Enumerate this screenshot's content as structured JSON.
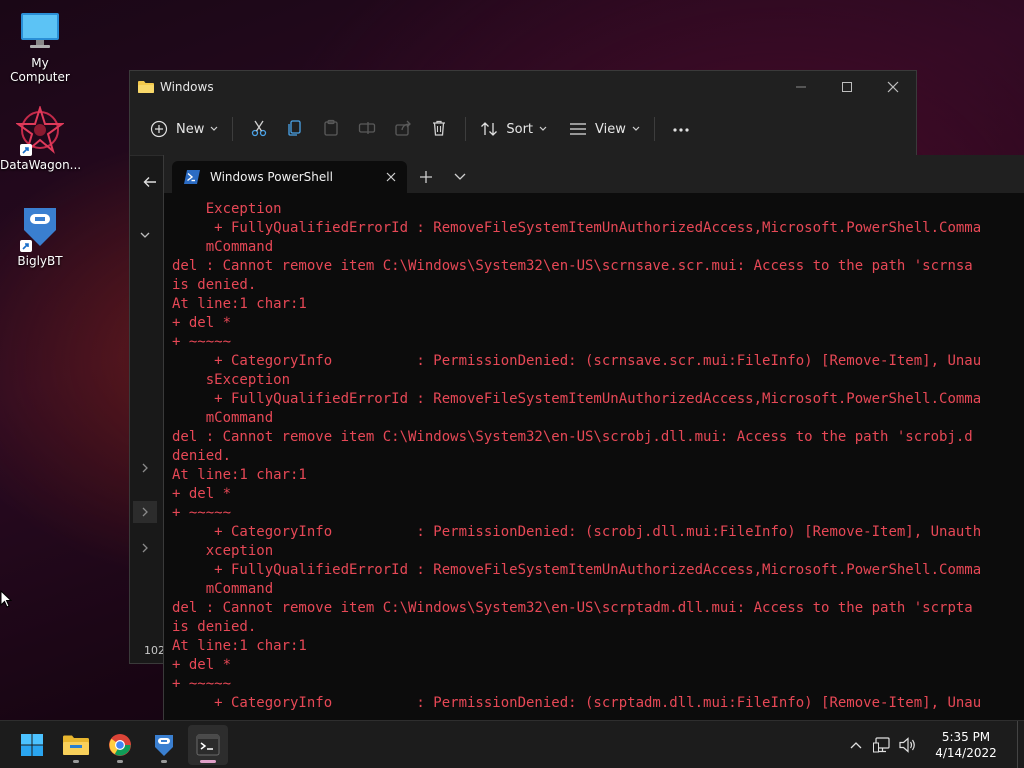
{
  "desktop": {
    "icons": [
      {
        "label": "My Computer"
      },
      {
        "label": "DataWagon..."
      },
      {
        "label": "BiglyBT"
      }
    ]
  },
  "explorer": {
    "title": "Windows",
    "toolbar": {
      "new_label": "New",
      "sort_label": "Sort",
      "view_label": "View"
    },
    "status_count": "102"
  },
  "terminal": {
    "tab_title": "Windows PowerShell",
    "lines": [
      "    Exception",
      "     + FullyQualifiedErrorId : RemoveFileSystemItemUnAuthorizedAccess,Microsoft.PowerShell.Comma",
      "    mCommand",
      "del : Cannot remove item C:\\Windows\\System32\\en-US\\scrnsave.scr.mui: Access to the path 'scrnsa",
      "is denied.",
      "At line:1 char:1",
      "+ del *",
      "+ ~~~~~",
      "     + CategoryInfo          : PermissionDenied: (scrnsave.scr.mui:FileInfo) [Remove-Item], Unau",
      "    sException",
      "     + FullyQualifiedErrorId : RemoveFileSystemItemUnAuthorizedAccess,Microsoft.PowerShell.Comma",
      "    mCommand",
      "del : Cannot remove item C:\\Windows\\System32\\en-US\\scrobj.dll.mui: Access to the path 'scrobj.d",
      "denied.",
      "At line:1 char:1",
      "+ del *",
      "+ ~~~~~",
      "     + CategoryInfo          : PermissionDenied: (scrobj.dll.mui:FileInfo) [Remove-Item], Unauth",
      "    xception",
      "     + FullyQualifiedErrorId : RemoveFileSystemItemUnAuthorizedAccess,Microsoft.PowerShell.Comma",
      "    mCommand",
      "del : Cannot remove item C:\\Windows\\System32\\en-US\\scrptadm.dll.mui: Access to the path 'scrpta",
      "is denied.",
      "At line:1 char:1",
      "+ del *",
      "+ ~~~~~",
      "     + CategoryInfo          : PermissionDenied: (scrptadm.dll.mui:FileInfo) [Remove-Item], Unau"
    ],
    "text_color": "#e74856"
  },
  "taskbar": {
    "clock_time": "5:35 PM",
    "clock_date": "4/14/2022"
  },
  "colors": {
    "accent": "#0078d4",
    "folder": "#f3c94c"
  }
}
